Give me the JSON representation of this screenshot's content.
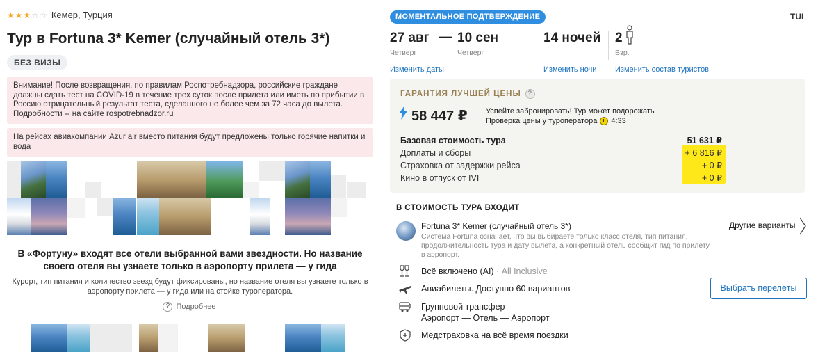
{
  "header": {
    "stars_full": 3,
    "stars_total": 5,
    "location": "Кемер, Турция",
    "title_prefix": "Тур в ",
    "title_hotel": "Fortuna 3* Kemer (случайный отель 3*)",
    "visa_badge": "БЕЗ ВИЗЫ"
  },
  "notices": [
    "Внимание! После возвращения, по правилам Роспотребнадзора, российские граждане должны сдать тест на COVID-19 в течение трех суток после прилета или иметь по прибытии в Россию отрицательный результат теста, сделанного не более чем за 72 часа до вылета. Подробности -- на сайте rospotrebnadzor.ru",
    "На рейсах авиакомпании Azur air вместо питания будут предложены только горячие напитки и вода"
  ],
  "promo": {
    "title": "В «Фортуну» входят все отели выбранной вами звездности. Но название своего отеля вы узнаете только в аэропорту прилета — у гида",
    "description": "Курорт, тип питания и количество звезд будут фиксированы, но название отеля вы узнаете только в аэропорту прилета — у гида или на стойке туроператора.",
    "more_link": "Подробнее",
    "help_glyph": "?"
  },
  "tour": {
    "confirm_badge": "МОМЕНТАЛЬНОЕ ПОДТВЕРЖДЕНИЕ",
    "operator": "TUI",
    "date_from": "27 авг",
    "date_dash": "—",
    "date_to": "10 сен",
    "weekday_from": "Четверг",
    "weekday_to": "Четверг",
    "nights": "14 ночей",
    "tourists_count": "2",
    "tourists_label": "Взр.",
    "change_dates": "Изменить даты",
    "change_nights": "Изменить ночи",
    "change_tourists": "Изменить состав туристов"
  },
  "price": {
    "guarantee": "ГАРАНТИЯ ЛУЧШЕЙ ЦЕНЫ",
    "help_glyph": "?",
    "total": "58 447 ₽",
    "hurry_line1": "Успейте забронировать! Тур может подорожать",
    "hurry_line2": "Проверка цены у туроператора",
    "timer": "4:33",
    "rows": [
      {
        "label": "Базовая стоимость тура",
        "value": "51 631 ₽"
      },
      {
        "label": "Доплаты и сборы",
        "value": "+ 6 816 ₽"
      },
      {
        "label": "Страховка от задержки рейса",
        "value": "+ 0 ₽"
      },
      {
        "label": "Кино в отпуск от IVI",
        "value": "+ 0 ₽"
      }
    ]
  },
  "included": {
    "title": "В СТОИМОСТЬ ТУРА ВХОДИТ",
    "hotel_name": "Fortuna 3* Kemer (случайный отель 3*)",
    "hotel_desc": "Система Fortuna означает, что вы выбираете только класс отеля, тип питания, продолжительность тура и дату вылета, а конкретный отель сообщит гид по прилету в аэропорт.",
    "other_variants": "Другие варианты",
    "meal": "Всё включено (AI)",
    "meal_extra": " · All Inclusive",
    "flights": "Авиабилеты. Доступно 60 вариантов",
    "choose_flights": "Выбрать перелёты",
    "transfer": "Групповой трансфер",
    "transfer_route": "Аэропорт — Отель — Аэропорт",
    "insurance": "Медстраховка на всё время поездки"
  }
}
